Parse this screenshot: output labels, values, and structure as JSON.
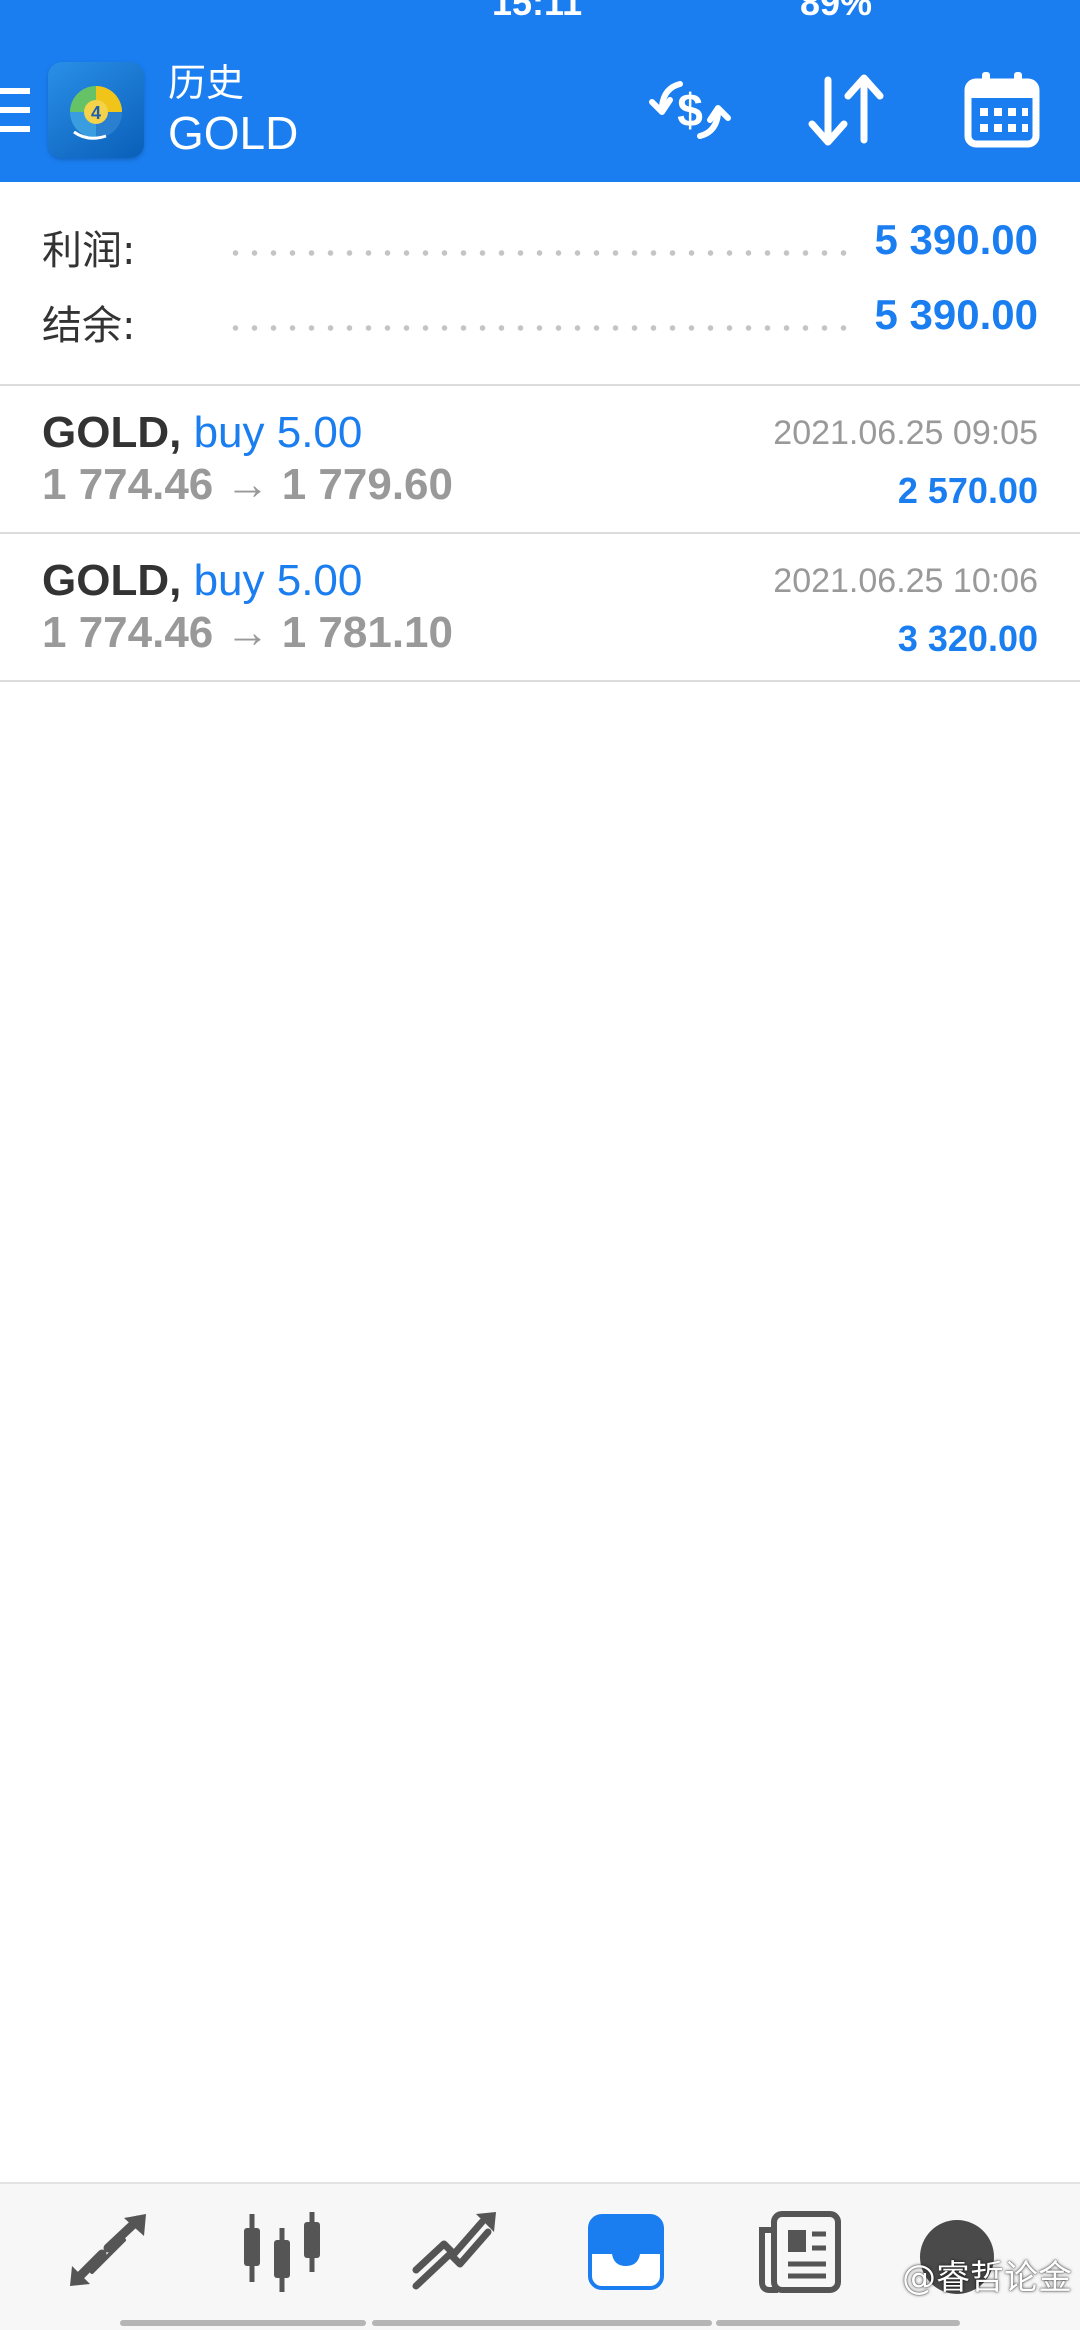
{
  "status_bar": {
    "time": "15:11",
    "battery": "89%"
  },
  "toolbar": {
    "title": "历史",
    "subtitle": "GOLD",
    "icons": {
      "menu": "menu-icon",
      "logo": "metatrader4-logo",
      "currency_exchange": "currency-exchange-icon",
      "sort": "sort-icon",
      "calendar": "calendar-icon"
    }
  },
  "summary": {
    "profit_label": "利润:",
    "profit_value": "5 390.00",
    "balance_label": "结余:",
    "balance_value": "5 390.00"
  },
  "deals": [
    {
      "symbol": "GOLD,",
      "type": "buy 5.00",
      "prices": "1 774.46 → 1 779.60",
      "time": "2021.06.25 09:05",
      "profit": "2 570.00"
    },
    {
      "symbol": "GOLD,",
      "type": "buy 5.00",
      "prices": "1 774.46 → 1 781.10",
      "time": "2021.06.25 10:06",
      "profit": "3 320.00"
    }
  ],
  "bottom_nav": {
    "items": [
      {
        "icon": "quotes-icon"
      },
      {
        "icon": "chart-icon"
      },
      {
        "icon": "trade-icon"
      },
      {
        "icon": "history-icon",
        "active": true
      },
      {
        "icon": "news-icon"
      }
    ],
    "watermark": "@睿哲论金"
  },
  "colors": {
    "accent": "#1a7ef0",
    "text_dark": "#333333",
    "text_gray": "#999999",
    "divider": "#dcdcdc"
  }
}
